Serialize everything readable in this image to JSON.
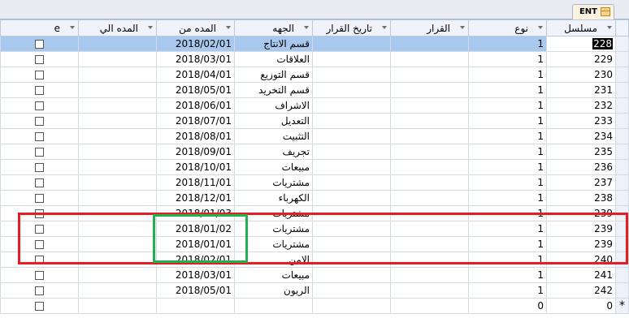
{
  "tab": {
    "label": "ENT",
    "icon": "table-icon"
  },
  "columns": [
    {
      "key": "serial",
      "label": "مسلسل",
      "sortable": true
    },
    {
      "key": "type",
      "label": "نوع",
      "sortable": true
    },
    {
      "key": "decision",
      "label": "القرار",
      "sortable": true
    },
    {
      "key": "decision_date",
      "label": "تاريخ القرار",
      "sortable": true
    },
    {
      "key": "department",
      "label": "الجهه",
      "sortable": true
    },
    {
      "key": "period_from",
      "label": "المده من",
      "sortable": true
    },
    {
      "key": "period_to",
      "label": "المده الي",
      "sortable": true
    },
    {
      "key": "e",
      "label": "e",
      "sortable": true
    }
  ],
  "rows": [
    {
      "serial": "228",
      "type": "1",
      "decision": "",
      "decision_date": "",
      "department": "قسم الانتاج",
      "period_from": "2018/02/01",
      "period_to": "",
      "e": false
    },
    {
      "serial": "229",
      "type": "1",
      "decision": "",
      "decision_date": "",
      "department": "العلاقات",
      "period_from": "2018/03/01",
      "period_to": "",
      "e": false
    },
    {
      "serial": "230",
      "type": "1",
      "decision": "",
      "decision_date": "",
      "department": "قسم التوزيع",
      "period_from": "2018/04/01",
      "period_to": "",
      "e": false
    },
    {
      "serial": "231",
      "type": "1",
      "decision": "",
      "decision_date": "",
      "department": "قسم التخريد",
      "period_from": "2018/05/01",
      "period_to": "",
      "e": false
    },
    {
      "serial": "232",
      "type": "1",
      "decision": "",
      "decision_date": "",
      "department": "الاشراف",
      "period_from": "2018/06/01",
      "period_to": "",
      "e": false
    },
    {
      "serial": "233",
      "type": "1",
      "decision": "",
      "decision_date": "",
      "department": "التعديل",
      "period_from": "2018/07/01",
      "period_to": "",
      "e": false
    },
    {
      "serial": "234",
      "type": "1",
      "decision": "",
      "decision_date": "",
      "department": "التثبيت",
      "period_from": "2018/08/01",
      "period_to": "",
      "e": false
    },
    {
      "serial": "235",
      "type": "1",
      "decision": "",
      "decision_date": "",
      "department": "تجريف",
      "period_from": "2018/09/01",
      "period_to": "",
      "e": false
    },
    {
      "serial": "236",
      "type": "1",
      "decision": "",
      "decision_date": "",
      "department": "مبيعات",
      "period_from": "2018/10/01",
      "period_to": "",
      "e": false
    },
    {
      "serial": "237",
      "type": "1",
      "decision": "",
      "decision_date": "",
      "department": "مشتريات",
      "period_from": "2018/11/01",
      "period_to": "",
      "e": false
    },
    {
      "serial": "238",
      "type": "1",
      "decision": "",
      "decision_date": "",
      "department": "الكهرباء",
      "period_from": "2018/12/01",
      "period_to": "",
      "e": false
    },
    {
      "serial": "239",
      "type": "1",
      "decision": "",
      "decision_date": "",
      "department": "مشتريات",
      "period_from": "2018/01/03",
      "period_to": "",
      "e": false
    },
    {
      "serial": "239",
      "type": "1",
      "decision": "",
      "decision_date": "",
      "department": "مشتريات",
      "period_from": "2018/01/02",
      "period_to": "",
      "e": false
    },
    {
      "serial": "239",
      "type": "1",
      "decision": "",
      "decision_date": "",
      "department": "مشتريات",
      "period_from": "2018/01/01",
      "period_to": "",
      "e": false
    },
    {
      "serial": "240",
      "type": "1",
      "decision": "",
      "decision_date": "",
      "department": "الامن",
      "period_from": "2018/02/01",
      "period_to": "",
      "e": false
    },
    {
      "serial": "241",
      "type": "1",
      "decision": "",
      "decision_date": "",
      "department": "مبيعات",
      "period_from": "2018/03/01",
      "period_to": "",
      "e": false
    },
    {
      "serial": "242",
      "type": "1",
      "decision": "",
      "decision_date": "",
      "department": "الريون",
      "period_from": "2018/05/01",
      "period_to": "",
      "e": false
    }
  ],
  "new_row": {
    "serial": "0",
    "type": "0",
    "marker": "*"
  },
  "highlight_colors": {
    "red_box": "#e41e24",
    "green_box": "#22b14c",
    "selected_row": "#a9c8ed"
  }
}
